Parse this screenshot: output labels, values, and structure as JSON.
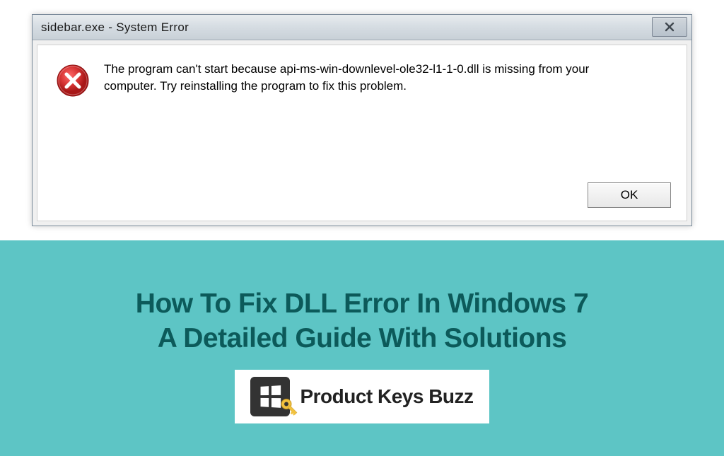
{
  "dialog": {
    "title": "sidebar.exe - System Error",
    "message": "The program can't start because api-ms-win-downlevel-ole32-l1-1-0.dll is missing from your computer. Try reinstalling the program to fix this problem.",
    "ok_label": "OK"
  },
  "article": {
    "headline_line1": "How To Fix DLL Error In Windows 7",
    "headline_line2": "A Detailed Guide With Solutions"
  },
  "branding": {
    "logo_text": "Product Keys Buzz"
  },
  "colors": {
    "teal_bg": "#5dc5c5",
    "teal_text": "#0c5a5a",
    "error_red": "#d63434",
    "key_yellow": "#f2c23e"
  }
}
